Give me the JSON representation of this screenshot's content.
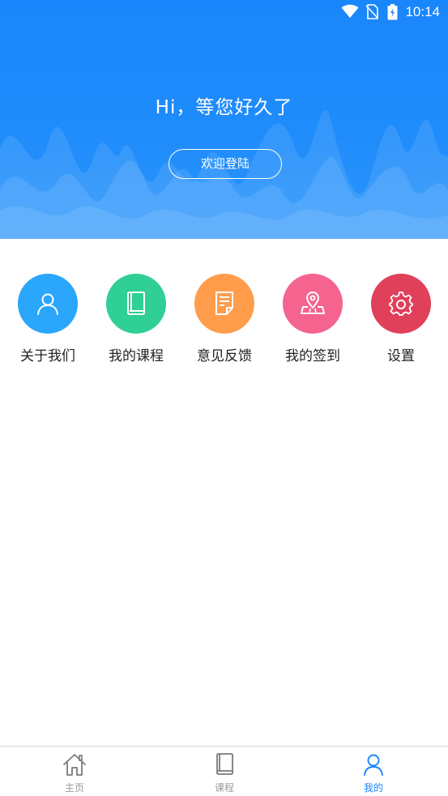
{
  "status_bar": {
    "time": "10:14"
  },
  "header": {
    "greeting": "Hi，等您好久了",
    "login_button": "欢迎登陆"
  },
  "menu": [
    {
      "label": "关于我们",
      "icon": "user-icon",
      "color": "#2aa6fa"
    },
    {
      "label": "我的课程",
      "icon": "book-icon",
      "color": "#2fcf95"
    },
    {
      "label": "意见反馈",
      "icon": "document-icon",
      "color": "#ff9d4d"
    },
    {
      "label": "我的签到",
      "icon": "map-pin-icon",
      "color": "#f5638f"
    },
    {
      "label": "设置",
      "icon": "gear-icon",
      "color": "#e0405a"
    }
  ],
  "bottom_nav": [
    {
      "label": "主页",
      "icon": "home-icon",
      "active": false
    },
    {
      "label": "课程",
      "icon": "book-icon",
      "active": false
    },
    {
      "label": "我的",
      "icon": "user-icon",
      "active": true
    }
  ],
  "colors": {
    "accent": "#1a86fb",
    "inactive": "#9a9a9a"
  }
}
